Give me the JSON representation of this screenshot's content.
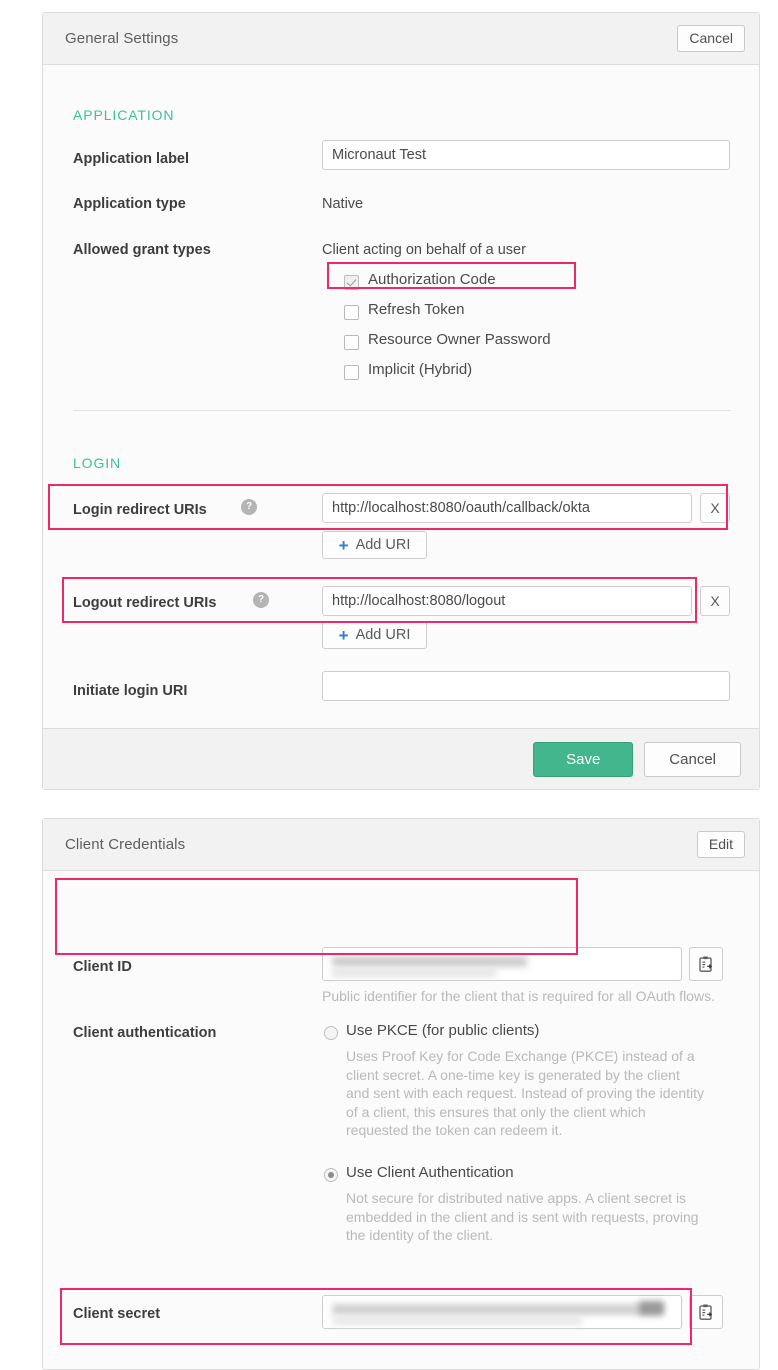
{
  "general_settings": {
    "title": "General Settings",
    "cancel_label": "Cancel",
    "application": {
      "section_title": "APPLICATION",
      "app_label_label": "Application label",
      "app_label_value": "Micronaut Test",
      "app_type_label": "Application type",
      "app_type_value": "Native",
      "grant_types_label": "Allowed grant types",
      "grant_group_caption": "Client acting on behalf of a user",
      "grants": [
        {
          "label": "Authorization Code",
          "checked": true,
          "disabled": true
        },
        {
          "label": "Refresh Token",
          "checked": false,
          "disabled": false
        },
        {
          "label": "Resource Owner Password",
          "checked": false,
          "disabled": false
        },
        {
          "label": "Implicit (Hybrid)",
          "checked": false,
          "disabled": false
        }
      ]
    },
    "login": {
      "section_title": "LOGIN",
      "login_redirect_label": "Login redirect URIs",
      "login_redirect_value": "http://localhost:8080/oauth/callback/okta",
      "logout_redirect_label": "Logout redirect URIs",
      "logout_redirect_value": "http://localhost:8080/logout",
      "initiate_login_label": "Initiate login URI",
      "initiate_login_value": "",
      "add_uri_label": "Add URI",
      "plus_glyph": "+",
      "remove_glyph": "X",
      "help_glyph": "?"
    },
    "footer": {
      "save_label": "Save",
      "cancel_label": "Cancel"
    }
  },
  "client_credentials": {
    "title": "Client Credentials",
    "edit_label": "Edit",
    "client_id_label": "Client ID",
    "client_id_value": "",
    "client_id_help": "Public identifier for the client that is required for all OAuth flows.",
    "client_auth_label": "Client authentication",
    "options": [
      {
        "label": "Use PKCE (for public clients)",
        "selected": false,
        "description": "Uses Proof Key for Code Exchange (PKCE) instead of a client secret. A one-time key is generated by the client and sent with each request. Instead of proving the identity of a client, this ensures that only the client which requested the token can redeem it."
      },
      {
        "label": "Use Client Authentication",
        "selected": true,
        "description": "Not secure for distributed native apps. A client secret is embedded in the client and is sent with requests, proving the identity of the client."
      }
    ],
    "client_secret_label": "Client secret",
    "client_secret_value": ""
  },
  "colors": {
    "accent_green": "#3ec294",
    "save_green": "#43b68e",
    "highlight_pink": "#ec2a66",
    "link_blue": "#2b7fd4",
    "panel_bg": "#fbfbfb",
    "header_bg": "#f2f2f2",
    "border": "#dcdcdc",
    "muted_text": "#b9b9b9"
  },
  "icons": {
    "copy": "copy-to-clipboard-icon",
    "help": "help-circle-icon",
    "remove": "remove-icon",
    "plus": "plus-icon"
  }
}
